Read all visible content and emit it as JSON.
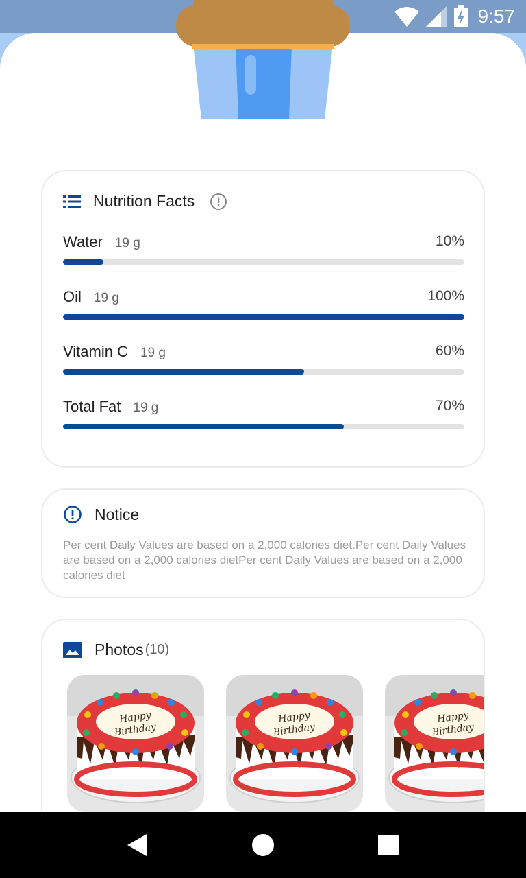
{
  "status_bar": {
    "time": "9:57",
    "icons": [
      "wifi-icon",
      "cell-signal-icon",
      "battery-charging-icon"
    ]
  },
  "nutrition": {
    "title": "Nutrition Facts",
    "icons": [
      "list-icon",
      "info-icon"
    ],
    "items": [
      {
        "name": "Water",
        "amount": "19 g",
        "percent": "10%",
        "value": 10
      },
      {
        "name": "Oil",
        "amount": "19 g",
        "percent": "100%",
        "value": 100
      },
      {
        "name": "Vitamin C",
        "amount": "19 g",
        "percent": "60%",
        "value": 60
      },
      {
        "name": "Total Fat",
        "amount": "19 g",
        "percent": "70%",
        "value": 70
      }
    ]
  },
  "notice": {
    "title": "Notice",
    "icon": "alert-circle-icon",
    "text": "Per cent Daily Values are based on a 2,000 calories diet.Per cent Daily Values are based on a 2,000 calories dietPer cent Daily Values are based on a 2,000 calories diet"
  },
  "photos": {
    "title": "Photos",
    "count": "(10)",
    "icon": "image-icon",
    "items": [
      {
        "caption": "Happy Birthday"
      },
      {
        "caption": "Happy Birthday"
      },
      {
        "caption": "Happy Birthday"
      }
    ]
  },
  "nav_bar": {
    "icons": [
      "back-icon",
      "home-icon",
      "recents-icon"
    ]
  },
  "colors": {
    "accent": "#0d4a93",
    "status_bar": "#7a9cc6",
    "bar_track": "#e3e3e3"
  }
}
